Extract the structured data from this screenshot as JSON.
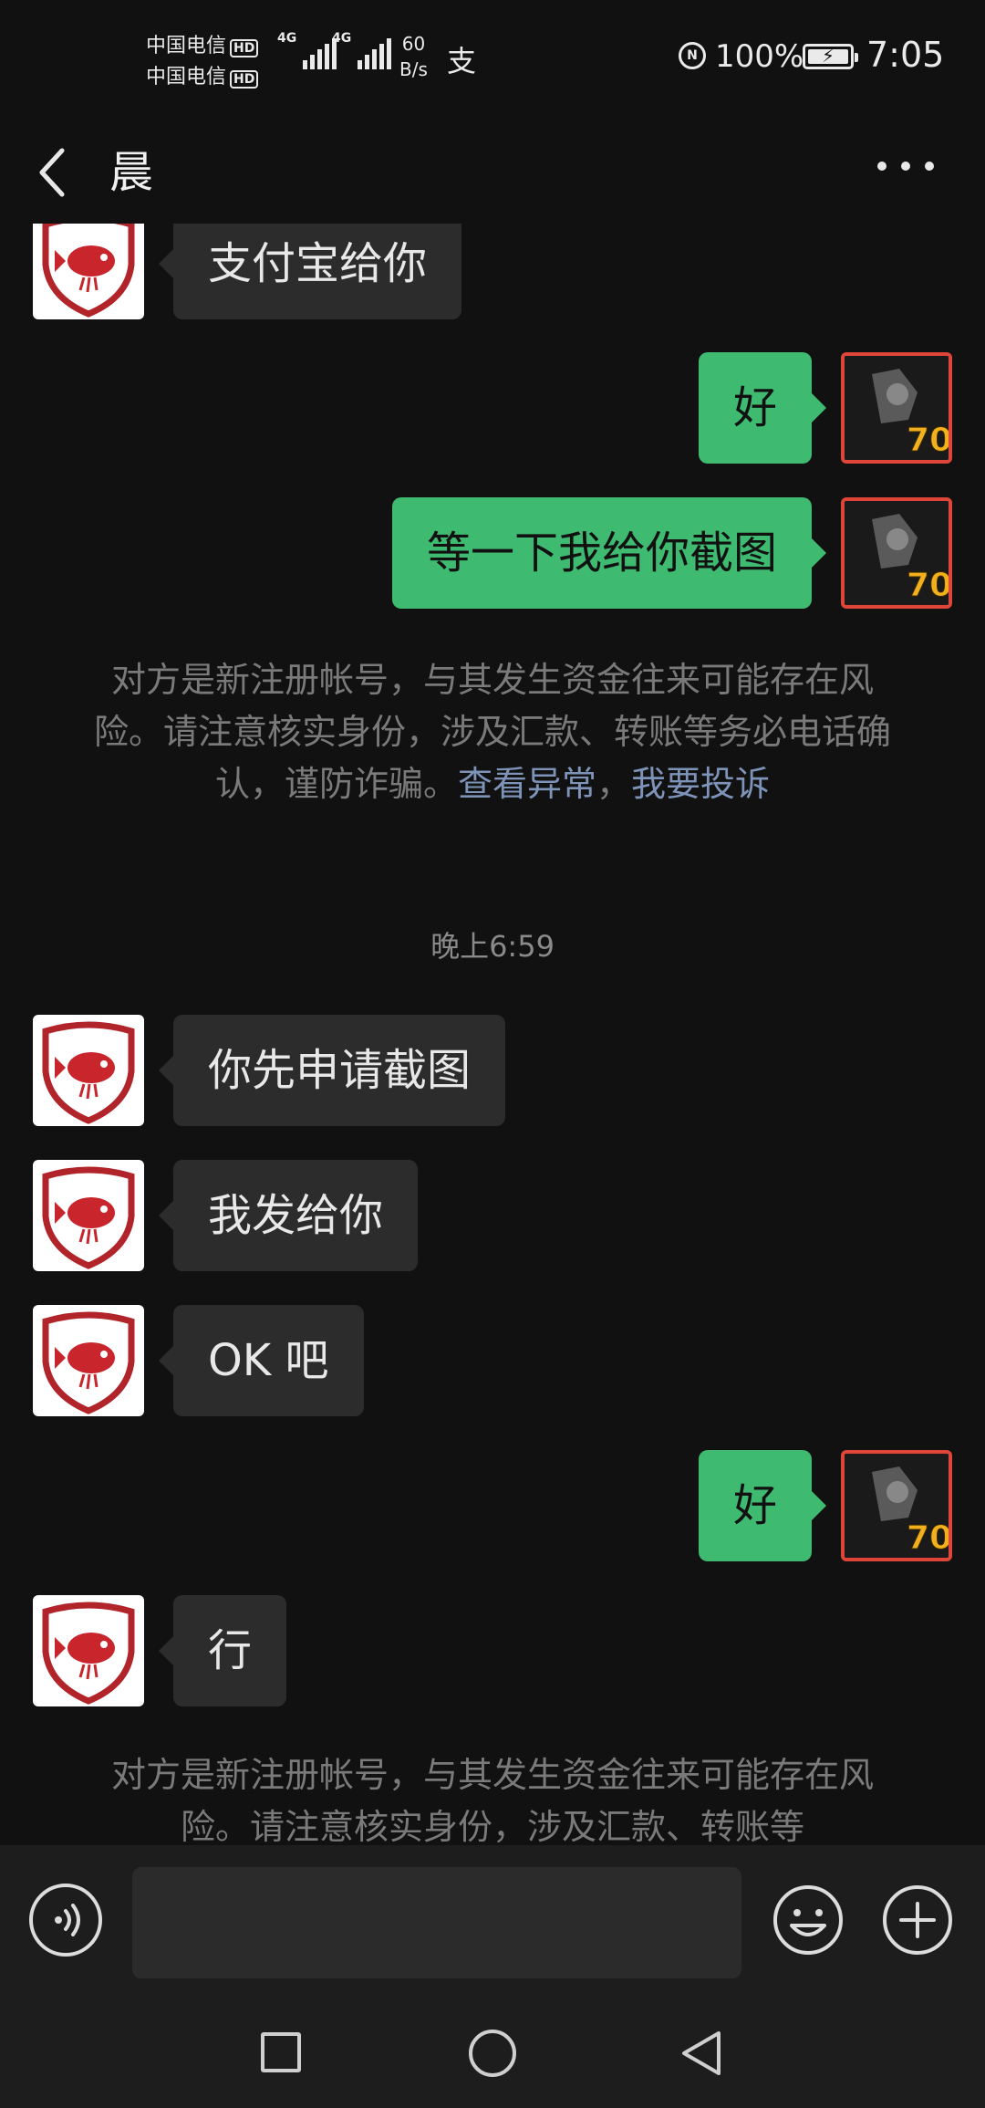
{
  "status_bar": {
    "carrier1": "中国电信",
    "carrier2": "中国电信",
    "hd_label": "HD",
    "network1": "4G",
    "network2": "4G",
    "speed_value": "60",
    "speed_unit": "B/s",
    "alipay_glyph": "支",
    "nfc_label": "N",
    "battery": "100%",
    "battery_level": 1.0,
    "time": "7:05"
  },
  "header": {
    "title": "晨",
    "back_icon": "chevron-left-icon",
    "more_icon": "more-dots-icon"
  },
  "colors": {
    "background": "#111111",
    "bubble_other": "#2c2c2c",
    "bubble_self": "#3ebb71",
    "link": "#7d93b8",
    "system_text": "#7a7a7a"
  },
  "messages": [
    {
      "sender": "other",
      "text": "支付宝给你"
    },
    {
      "sender": "self",
      "text": "好"
    },
    {
      "sender": "self",
      "text": "等一下我给你截图"
    },
    {
      "sender": "other",
      "text": "你先申请截图"
    },
    {
      "sender": "other",
      "text": "我发给你"
    },
    {
      "sender": "other",
      "text": "OK 吧"
    },
    {
      "sender": "self",
      "text": "好"
    },
    {
      "sender": "other",
      "text": "行"
    }
  ],
  "system_notice_1": {
    "text": "对方是新注册帐号，与其发生资金往来可能存在风险。请注意核实身份，涉及汇款、转账等务必电话确认，谨防诈骗。",
    "link1": "查看异常",
    "separator": "，",
    "link2": "我要投诉"
  },
  "timestamp": "晚上6:59",
  "system_notice_2": {
    "text": "对方是新注册帐号，与其发生资金往来可能存在风险。请注意核实身份，涉及汇款、转账等"
  },
  "input_bar": {
    "voice_icon": "voice-icon",
    "placeholder": "",
    "emoji_icon": "emoji-icon",
    "plus_icon": "plus-icon"
  },
  "nav_bar": {
    "recent_icon": "recent-apps-icon",
    "home_icon": "home-icon",
    "back_icon": "back-triangle-icon"
  }
}
